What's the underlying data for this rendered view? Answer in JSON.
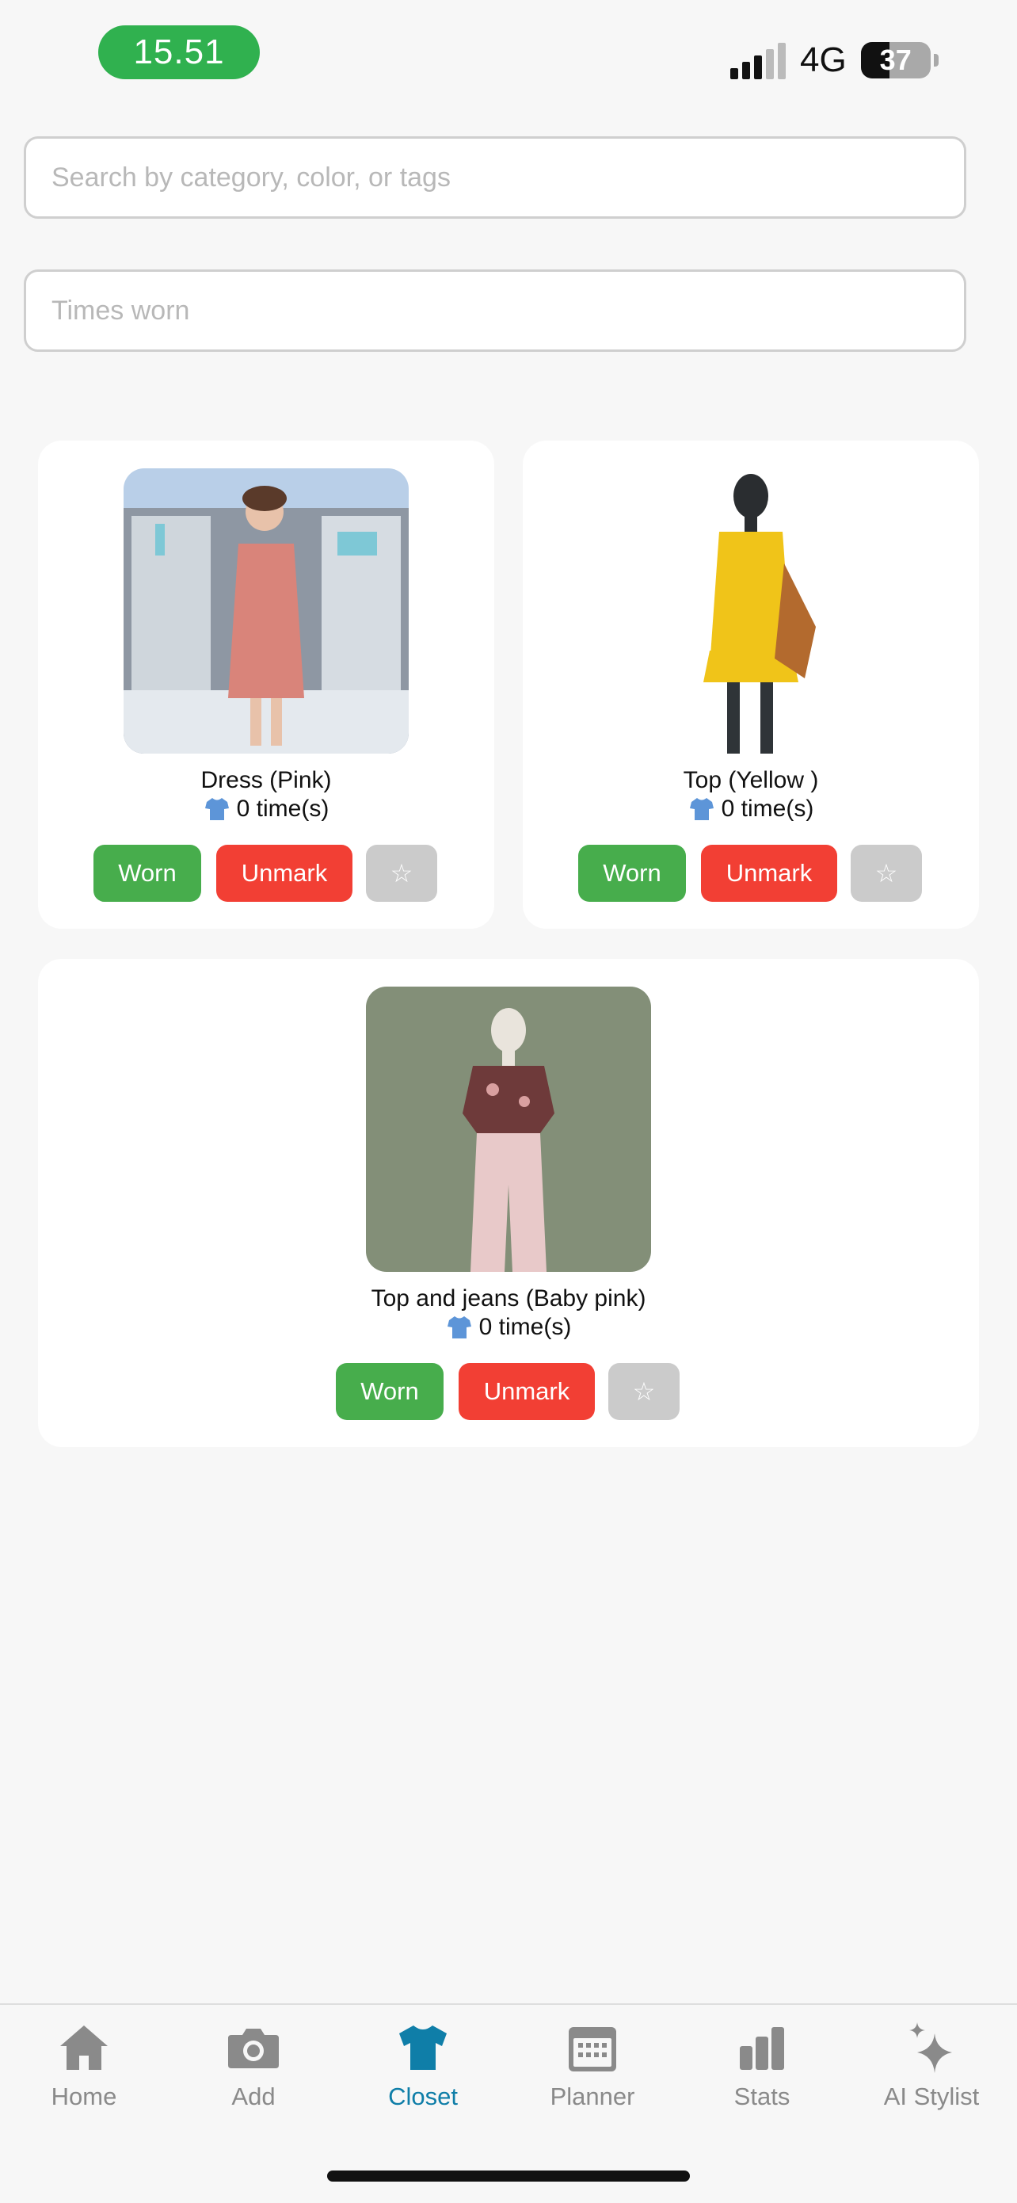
{
  "status_bar": {
    "time": "15.51",
    "network": "4G",
    "battery": "37"
  },
  "search": {
    "placeholder": "Search by category, color, or tags"
  },
  "times_worn": {
    "placeholder": "Times worn"
  },
  "items": [
    {
      "title": "Dress (Pink)",
      "worn_count": "0 time(s)",
      "worn_label": "Worn",
      "unmark_label": "Unmark",
      "favorite_label": "☆"
    },
    {
      "title": "Top (Yellow )",
      "worn_count": "0 time(s)",
      "worn_label": "Worn",
      "unmark_label": "Unmark",
      "favorite_label": "☆"
    },
    {
      "title": "Top and jeans (Baby pink)",
      "worn_count": "0 time(s)",
      "worn_label": "Worn",
      "unmark_label": "Unmark",
      "favorite_label": "☆"
    }
  ],
  "tabs": [
    {
      "label": "Home",
      "icon": "home-icon"
    },
    {
      "label": "Add",
      "icon": "camera-icon"
    },
    {
      "label": "Closet",
      "icon": "tshirt-icon",
      "active": true
    },
    {
      "label": "Planner",
      "icon": "calendar-icon"
    },
    {
      "label": "Stats",
      "icon": "bar-chart-icon"
    },
    {
      "label": "AI Stylist",
      "icon": "sparkles-icon"
    }
  ],
  "colors": {
    "accent": "#0f7ea8",
    "worn": "#47ad4c",
    "unmark": "#f23f34",
    "favorite": "#cbcbcb",
    "time_pill": "#30b14f"
  }
}
